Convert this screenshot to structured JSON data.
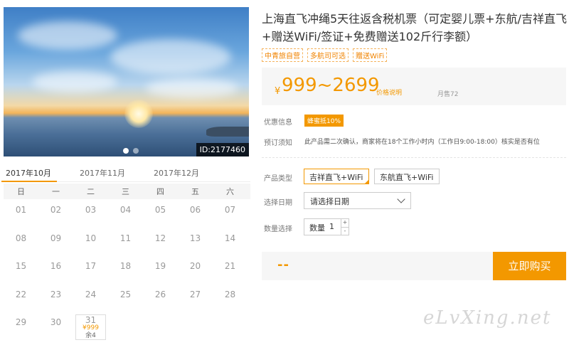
{
  "hero": {
    "image_id": "ID:2177460",
    "slide_count": 2,
    "active_slide": 1
  },
  "calendar": {
    "months": [
      "2017年10月",
      "2017年11月",
      "2017年12月"
    ],
    "active_month": 0,
    "weekdays": [
      "日",
      "一",
      "二",
      "三",
      "四",
      "五",
      "六"
    ],
    "days": [
      "01",
      "02",
      "03",
      "04",
      "05",
      "06",
      "07",
      "08",
      "09",
      "10",
      "11",
      "12",
      "13",
      "14",
      "15",
      "16",
      "17",
      "18",
      "19",
      "20",
      "21",
      "22",
      "23",
      "24",
      "25",
      "26",
      "27",
      "28",
      "29",
      "30"
    ],
    "special_day": {
      "day": "31",
      "price": "¥999",
      "stock": "余4"
    }
  },
  "product": {
    "title": "上海直飞冲绳5天往返含税机票（可定婴儿票+东航/吉祥直飞+赠送WiFi/签证+免费赠送102斤行李额）",
    "tags": [
      "中青旅自营",
      "多航司可选",
      "赠送WiFi"
    ],
    "price": {
      "currency": "¥",
      "range": "999~2699",
      "note": "价格说明",
      "sales": "月售72"
    },
    "promo_label": "优惠信息",
    "promo_badge": "蜂蜜抵10%",
    "notice_label": "预订须知",
    "notice_text": "此产品需二次确认，商家将在18个工作小时内（工作日9:00-18:00）核实是否有位"
  },
  "options": {
    "type_label": "产品类型",
    "types": [
      "吉祥直飞+WiFi",
      "东航直飞+WiFi"
    ],
    "selected_type": 0,
    "date_label": "选择日期",
    "date_placeholder": "请选择日期",
    "qty_label": "数量选择",
    "qty_prefix": "数量",
    "qty_value": "1",
    "qty_plus": "+",
    "qty_minus": "-"
  },
  "buy": {
    "total": "--",
    "button": "立即购买"
  },
  "watermark": "eLvXing.net",
  "colors": {
    "accent": "#f39800"
  }
}
